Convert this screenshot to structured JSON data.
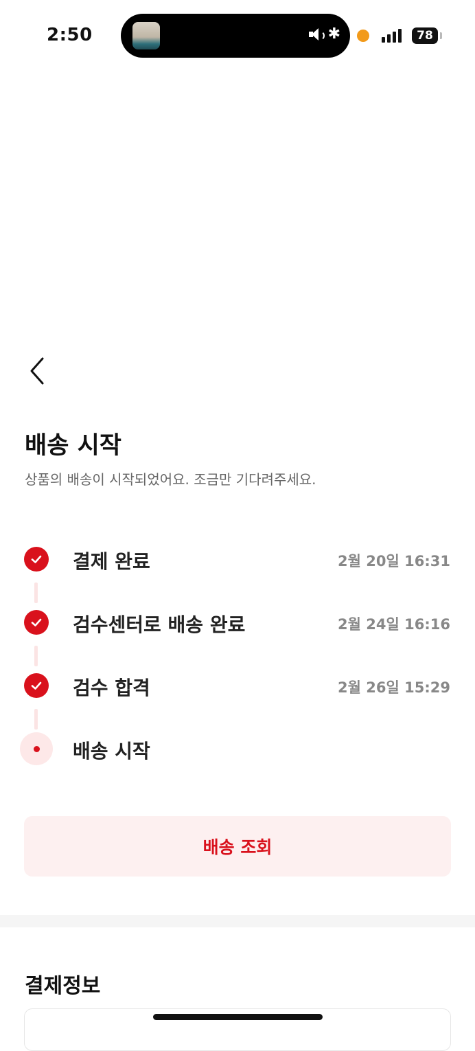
{
  "status_bar": {
    "time": "2:50",
    "battery": "78",
    "icons": [
      "speaker-icon",
      "bluetooth-icon",
      "orange-dot-icon",
      "signal-icon",
      "battery-icon"
    ]
  },
  "header": {
    "back_icon": "chevron-left-icon",
    "title": "배송 시작",
    "subtitle": "상품의 배송이 시작되었어요. 조금만 기다려주세요."
  },
  "timeline": {
    "accent_color": "#d9111c",
    "steps": [
      {
        "label": "결제 완료",
        "date": "2월 20일 16:31",
        "status": "done"
      },
      {
        "label": "검수센터로 배송 완료",
        "date": "2월 24일 16:16",
        "status": "done"
      },
      {
        "label": "검수 합격",
        "date": "2월 26일 15:29",
        "status": "done"
      },
      {
        "label": "배송 시작",
        "date": "",
        "status": "current"
      }
    ]
  },
  "actions": {
    "track_label": "배송 조회"
  },
  "payment": {
    "section_title": "결제정보"
  }
}
